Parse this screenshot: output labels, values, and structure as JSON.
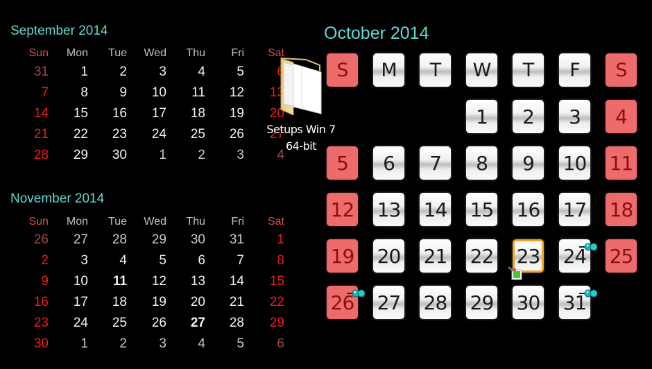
{
  "september": {
    "title": "September 2014",
    "headers": [
      "Sun",
      "Mon",
      "Tue",
      "Wed",
      "Thu",
      "Fri",
      "Sat"
    ],
    "weeks": [
      [
        {
          "d": "31",
          "o": true
        },
        {
          "d": "1"
        },
        {
          "d": "2"
        },
        {
          "d": "3"
        },
        {
          "d": "4"
        },
        {
          "d": "5"
        },
        {
          "d": "6"
        }
      ],
      [
        {
          "d": "7"
        },
        {
          "d": "8"
        },
        {
          "d": "9"
        },
        {
          "d": "10"
        },
        {
          "d": "11"
        },
        {
          "d": "12"
        },
        {
          "d": "13"
        }
      ],
      [
        {
          "d": "14"
        },
        {
          "d": "15"
        },
        {
          "d": "16"
        },
        {
          "d": "17"
        },
        {
          "d": "18"
        },
        {
          "d": "19"
        },
        {
          "d": "20"
        }
      ],
      [
        {
          "d": "21"
        },
        {
          "d": "22"
        },
        {
          "d": "23"
        },
        {
          "d": "24"
        },
        {
          "d": "25"
        },
        {
          "d": "26"
        },
        {
          "d": "27"
        }
      ],
      [
        {
          "d": "28"
        },
        {
          "d": "29"
        },
        {
          "d": "30"
        },
        {
          "d": "1",
          "o": true
        },
        {
          "d": "2",
          "o": true
        },
        {
          "d": "3",
          "o": true
        },
        {
          "d": "4",
          "o": true
        }
      ]
    ]
  },
  "november": {
    "title": "November 2014",
    "headers": [
      "Sun",
      "Mon",
      "Tue",
      "Wed",
      "Thu",
      "Fri",
      "Sat"
    ],
    "weeks": [
      [
        {
          "d": "26",
          "o": true
        },
        {
          "d": "27",
          "o": true
        },
        {
          "d": "28",
          "o": true
        },
        {
          "d": "29",
          "o": true
        },
        {
          "d": "30",
          "o": true
        },
        {
          "d": "31",
          "o": true
        },
        {
          "d": "1"
        }
      ],
      [
        {
          "d": "2"
        },
        {
          "d": "3"
        },
        {
          "d": "4"
        },
        {
          "d": "5"
        },
        {
          "d": "6"
        },
        {
          "d": "7"
        },
        {
          "d": "8"
        }
      ],
      [
        {
          "d": "9"
        },
        {
          "d": "10"
        },
        {
          "d": "11",
          "b": true
        },
        {
          "d": "12"
        },
        {
          "d": "13"
        },
        {
          "d": "14"
        },
        {
          "d": "15"
        }
      ],
      [
        {
          "d": "16"
        },
        {
          "d": "17"
        },
        {
          "d": "18"
        },
        {
          "d": "19"
        },
        {
          "d": "20"
        },
        {
          "d": "21"
        },
        {
          "d": "22"
        }
      ],
      [
        {
          "d": "23"
        },
        {
          "d": "24"
        },
        {
          "d": "25"
        },
        {
          "d": "26"
        },
        {
          "d": "27",
          "b": true
        },
        {
          "d": "28"
        },
        {
          "d": "29"
        }
      ],
      [
        {
          "d": "30"
        },
        {
          "d": "1",
          "o": true
        },
        {
          "d": "2",
          "o": true
        },
        {
          "d": "3",
          "o": true
        },
        {
          "d": "4",
          "o": true
        },
        {
          "d": "5",
          "o": true
        },
        {
          "d": "6",
          "o": true
        }
      ]
    ]
  },
  "october": {
    "title": "October 2014",
    "headers": [
      "S",
      "M",
      "T",
      "W",
      "T",
      "F",
      "S"
    ],
    "first_weekday_index": 3,
    "days_in_month": 31,
    "today": 23,
    "pinned_days": [
      24,
      26,
      31
    ]
  },
  "desktop_icon": {
    "icon": "folder-icon",
    "label_line1": "Setups Win 7",
    "label_line2": "64-bit"
  },
  "colors": {
    "title": "#5fd9d3",
    "weekend_text": "#ee1c1c",
    "weekend_tile": "#ee6b6b",
    "today_border": "#f4a51c",
    "pin": "#1bb5b5"
  }
}
